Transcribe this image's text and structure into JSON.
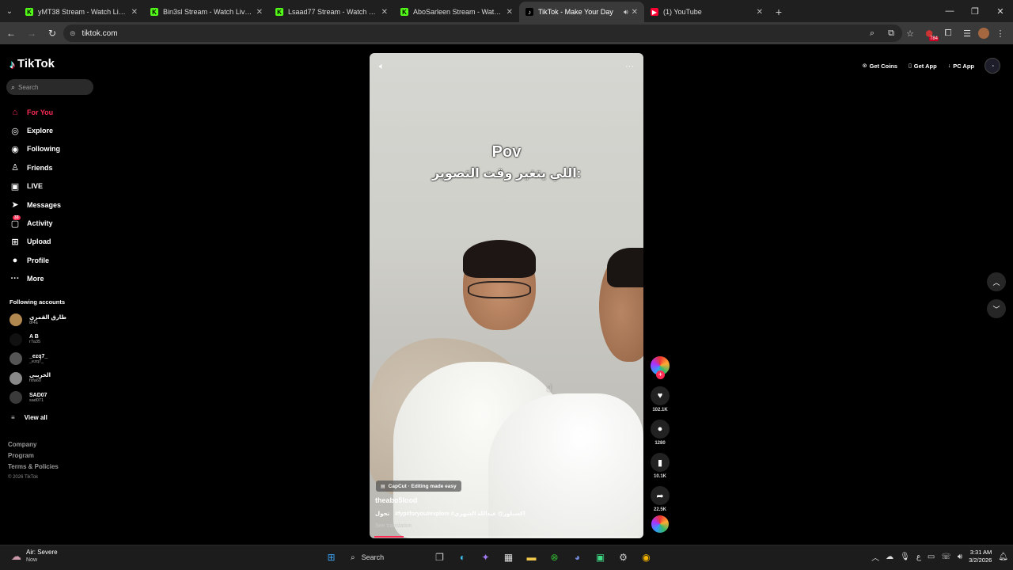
{
  "browser": {
    "tabs": [
      {
        "title": "yMT38 Stream - Watch Live on",
        "fav_color": "#53fc18",
        "fav_text": "K",
        "active": false
      },
      {
        "title": "Bin3sl Stream - Watch Live on",
        "fav_color": "#53fc18",
        "fav_text": "K",
        "active": false
      },
      {
        "title": "Lsaad77 Stream - Watch Live on",
        "fav_color": "#53fc18",
        "fav_text": "K",
        "active": false
      },
      {
        "title": "AboSarleen Stream - Watch Live",
        "fav_color": "#53fc18",
        "fav_text": "K",
        "active": false
      },
      {
        "title": "TikTok - Make Your Day",
        "fav_color": "#000000",
        "fav_text": "♪",
        "active": true
      },
      {
        "title": "(1) YouTube",
        "fav_color": "#ff0033",
        "fav_text": "▶",
        "active": false
      }
    ],
    "url": "tiktok.com",
    "extension_badge": "784"
  },
  "tiktok": {
    "logo_text": "TikTok",
    "search_placeholder": "Search",
    "nav": [
      {
        "label": "For You",
        "icon": "home-icon",
        "glyph": "⌂",
        "active": true
      },
      {
        "label": "Explore",
        "icon": "compass-icon",
        "glyph": "◎",
        "active": false
      },
      {
        "label": "Following",
        "icon": "following-icon",
        "glyph": "◉",
        "active": false
      },
      {
        "label": "Friends",
        "icon": "friends-icon",
        "glyph": "♙",
        "active": false
      },
      {
        "label": "LIVE",
        "icon": "live-icon",
        "glyph": "▣",
        "active": false
      },
      {
        "label": "Messages",
        "icon": "messages-icon",
        "glyph": "➤",
        "active": false
      },
      {
        "label": "Activity",
        "icon": "activity-icon",
        "glyph": "▢",
        "active": false,
        "badge": "33"
      },
      {
        "label": "Upload",
        "icon": "upload-icon",
        "glyph": "⊞",
        "active": false
      },
      {
        "label": "Profile",
        "icon": "profile-icon",
        "glyph": "●",
        "active": false
      },
      {
        "label": "More",
        "icon": "more-icon",
        "glyph": "···",
        "active": false
      }
    ],
    "following_header": "Following accounts",
    "accounts": [
      {
        "name": "طارق القمري",
        "handle": "8f4a",
        "color": "#b08850"
      },
      {
        "name": "A B",
        "handle": "r7a35",
        "color": "#111111"
      },
      {
        "name": "_ezq7_",
        "handle": "_ezq7_",
        "color": "#555555"
      },
      {
        "name": "الخريبي",
        "handle": "fxfa60",
        "color": "#888888"
      },
      {
        "name": "SAD07",
        "handle": "sad071",
        "color": "#3a3a3a"
      }
    ],
    "view_all": "View all",
    "footer": [
      "Company",
      "Program",
      "Terms & Policies"
    ],
    "copyright": "© 2026 TikTok",
    "header_actions": [
      {
        "label": "Get Coins",
        "icon": "coin-icon",
        "glyph": "⊙"
      },
      {
        "label": "Get App",
        "icon": "phone-icon",
        "glyph": "▯"
      },
      {
        "label": "PC App",
        "icon": "download-icon",
        "glyph": "↓"
      }
    ]
  },
  "video": {
    "overlay_title": "Pov",
    "overlay_caption": "اللي يتغير وقت التصوير:",
    "capcut_label": "CapCut · Editing made easy",
    "username": "theabo5lood",
    "description_tags": "#fyp#foryou#explore #اكسبلور@",
    "description_mention": "عبدالله الشهري",
    "description_extra": "تحول",
    "see_translation": "See translation",
    "progress": 0.11,
    "likes": "102.1K",
    "comments": "1280",
    "saves": "10.1K",
    "shares": "22.5K"
  },
  "taskbar": {
    "weather_title": "Air: Severe",
    "weather_sub": "Now",
    "search_label": "Search",
    "time": "3:31 AM",
    "date": "3/2/2026"
  }
}
